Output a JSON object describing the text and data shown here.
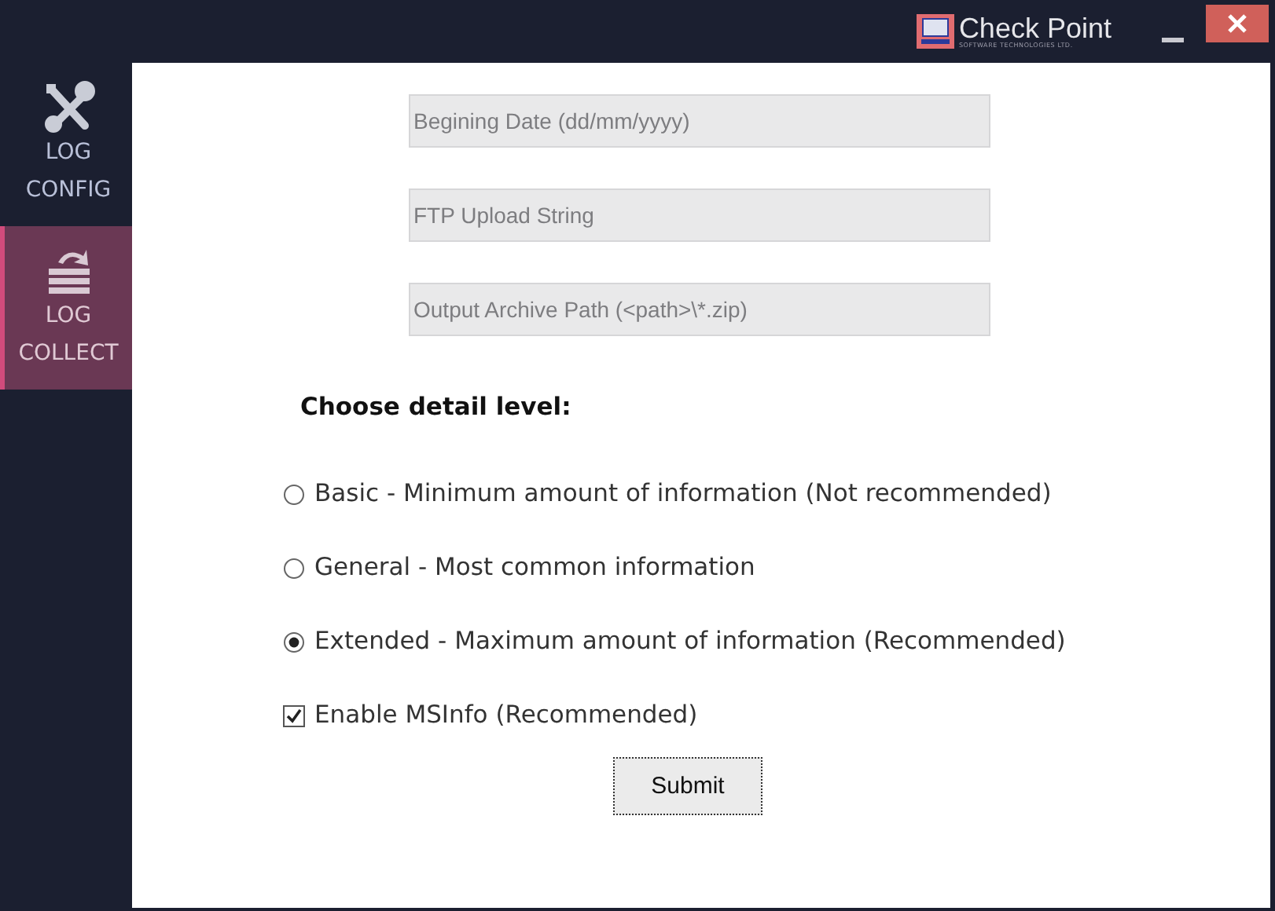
{
  "title_bar": {
    "logo_text": "Check Point",
    "logo_subtext": "SOFTWARE TECHNOLOGIES LTD."
  },
  "sidebar": {
    "items": [
      {
        "kind": "config",
        "lines": [
          "LOG",
          "CONFIG"
        ],
        "selected": false
      },
      {
        "kind": "collect",
        "lines": [
          "LOG",
          "COLLECT"
        ],
        "selected": true
      }
    ]
  },
  "fields": [
    {
      "placeholder": "Begining Date (dd/mm/yyyy)"
    },
    {
      "placeholder": "FTP Upload String"
    },
    {
      "placeholder": "Output Archive Path (<path>\\*.zip)"
    }
  ],
  "detail_heading": "Choose detail level:",
  "detail_levels": [
    {
      "label": "Basic - Minimum amount of information (Not recommended)",
      "selected": false
    },
    {
      "label": "General - Most common information",
      "selected": false
    },
    {
      "label": "Extended - Maximum amount of information (Recommended)",
      "selected": true
    }
  ],
  "msinfo": {
    "label": "Enable MSInfo (Recommended)",
    "checked": true
  },
  "submit_button": "Submit"
}
